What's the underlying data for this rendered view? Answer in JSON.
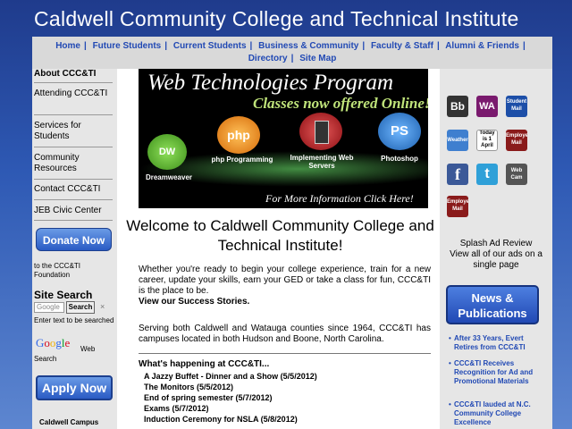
{
  "header": {
    "title": "Caldwell Community College and Technical Institute"
  },
  "nav": {
    "items": [
      "Home",
      "Future Students",
      "Current Students",
      "Business & Community",
      "Faculty & Staff",
      "Alumni & Friends",
      "Directory",
      "Site Map"
    ],
    "separator": "|"
  },
  "left": {
    "items": [
      "About CCC&TI",
      "Attending CCC&TI",
      "Services for Students",
      "Community Resources",
      "Contact CCC&TI",
      "JEB Civic Center"
    ],
    "donate_label": "Donate Now",
    "donate_caption": "to the CCC&TI Foundation",
    "site_search": {
      "heading": "Site Search",
      "placeholder": "Google",
      "button": "Search",
      "hint": "Enter text to be searched"
    },
    "google": {
      "logo": "Google",
      "web": "Web",
      "search": "Search"
    },
    "apply_label": "Apply Now",
    "campus": "Caldwell Campus"
  },
  "banner": {
    "title": "Web Technologies Program",
    "subtitle": "Classes now offered Online!",
    "more_info": "For More Information Click Here!",
    "items": [
      {
        "label": "Dreamweaver",
        "badge": "DW",
        "color": "#5bb82e"
      },
      {
        "label": "php Programming",
        "badge": "php",
        "color": "#f08a12"
      },
      {
        "label": "Implementing Web Servers",
        "badge": "",
        "color": "#c1121c"
      },
      {
        "label": "Photoshop",
        "badge": "PS",
        "color": "#2a7fd4"
      }
    ]
  },
  "main": {
    "welcome": "Welcome to Caldwell Community College and Technical Institute!",
    "intro": "Whether you're ready to begin your college experience, train for a new career, update your skills, earn your GED or take a class for fun, CCC&TI is the place to be.",
    "success_link": "View our Success Stories",
    "serving": "Serving both Caldwell and Watauga counties since 1964, CCC&TI has campuses located in both Hudson and Boone, North Carolina.",
    "happening_heading": "What's happening at CCC&TI...",
    "events": [
      "A Jazzy Buffet - Dinner and a Show  (5/5/2012)",
      "The Monitors  (5/5/2012)",
      "End of spring semester  (5/7/2012)",
      "Exams  (5/7/2012)",
      "Induction Ceremony for NSLA  (5/8/2012)"
    ]
  },
  "right": {
    "icons": [
      {
        "name": "blackboard-icon",
        "text": "Bb",
        "color": "#333333"
      },
      {
        "name": "webadvisor-icon",
        "text": "WA",
        "color": "#7a1a6e"
      },
      {
        "name": "student-mail-icon",
        "text": "Student Mail",
        "color": "#1d4fa8"
      },
      {
        "name": "weather-icon",
        "text": "Weather",
        "color": "#3f7fcf"
      },
      {
        "name": "calendar-icon",
        "text": "Today is 1 April",
        "color": "#ffffff"
      },
      {
        "name": "employee-mail-icon",
        "text": "Employee Mail",
        "color": "#8a1b1b"
      },
      {
        "name": "facebook-icon",
        "text": "f",
        "color": "#3b5998"
      },
      {
        "name": "twitter-icon",
        "text": "t",
        "color": "#2fa0d8"
      },
      {
        "name": "webcam-icon",
        "text": "Web Cam",
        "color": "#555555"
      },
      {
        "name": "employee-mail-2-icon",
        "text": "Employee Mail",
        "color": "#8a1b1b"
      }
    ],
    "splash": "Splash Ad Review",
    "view_all": "View all of our ads on a single page",
    "news_label": "News & Publications",
    "news_items": [
      "After 33 Years, Evert Retires from CCC&TI",
      "CCC&TI Receives Recognition for Ad and Promotional Materials",
      "CCC&TI lauded at N.C. Community College Excellence"
    ]
  }
}
